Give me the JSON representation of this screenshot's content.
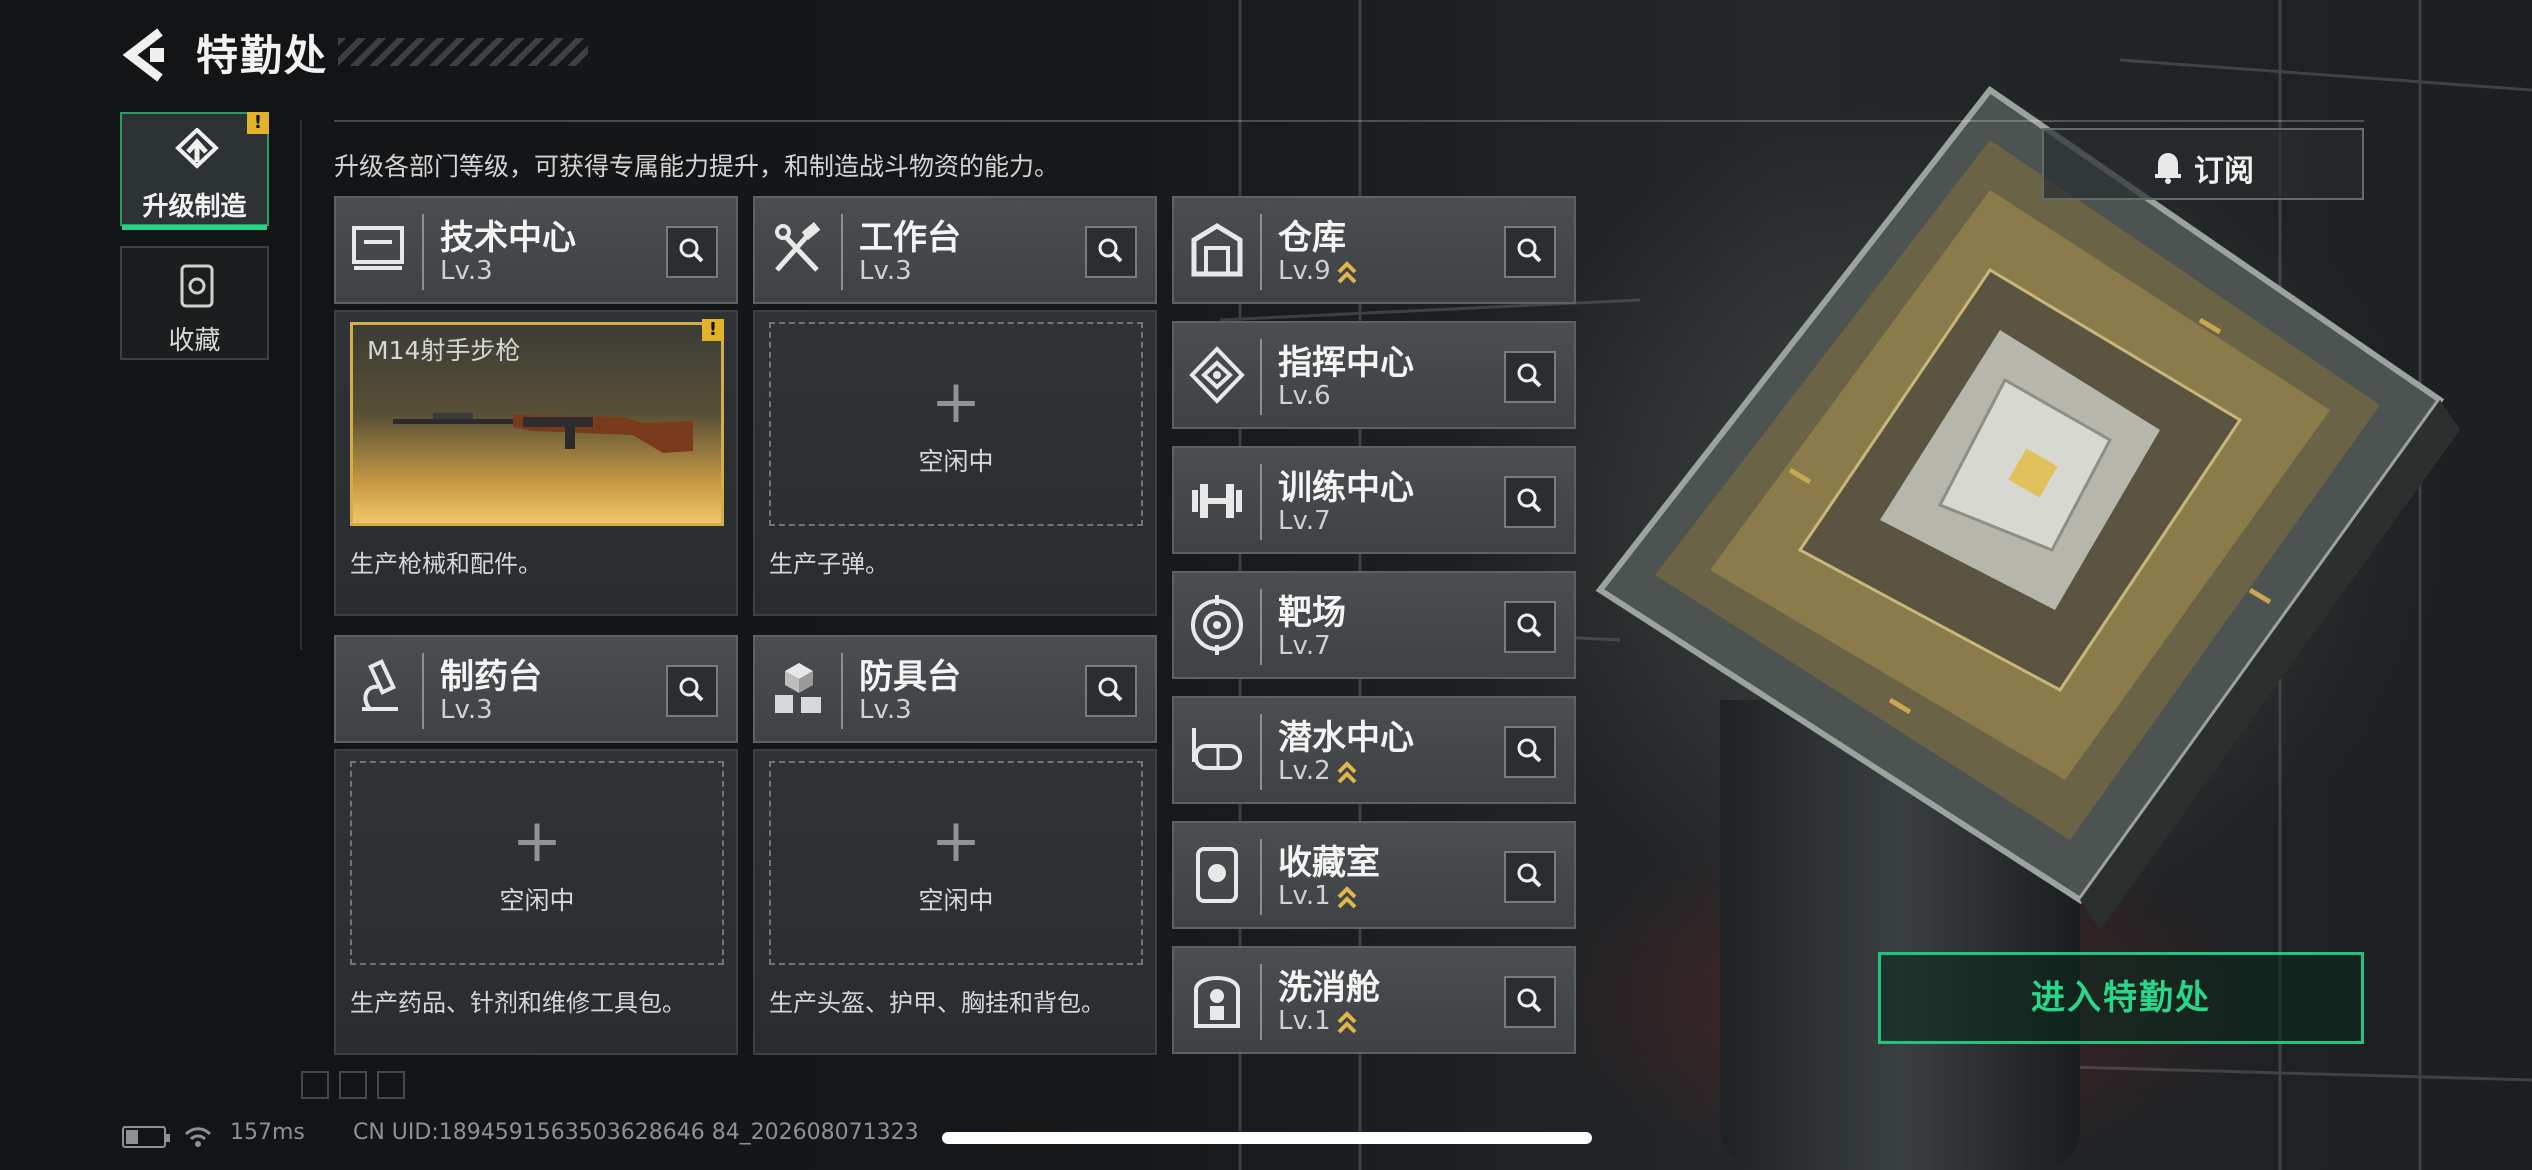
{
  "header": {
    "title": "特勤处"
  },
  "sidebar": {
    "tabs": [
      {
        "label": "升级制造",
        "active": true,
        "badge": "!"
      },
      {
        "label": "收藏",
        "active": false
      }
    ]
  },
  "subtitle": "升级各部门等级，可获得专属能力提升，和制造战斗物资的能力。",
  "production_depts": [
    {
      "name": "技术中心",
      "level": "Lv.3",
      "icon": "monitor-icon",
      "slot": {
        "state": "active",
        "item": "M14射手步枪",
        "badge": "!"
      },
      "description": "生产枪械和配件。"
    },
    {
      "name": "工作台",
      "level": "Lv.3",
      "icon": "tools-icon",
      "slot": {
        "state": "idle",
        "plus": "+",
        "label": "空闲中"
      },
      "description": "生产子弹。"
    },
    {
      "name": "制药台",
      "level": "Lv.3",
      "icon": "microscope-icon",
      "slot": {
        "state": "idle",
        "plus": "+",
        "label": "空闲中"
      },
      "description": "生产药品、针剂和维修工具包。"
    },
    {
      "name": "防具台",
      "level": "Lv.3",
      "icon": "armor-blocks-icon",
      "slot": {
        "state": "idle",
        "plus": "+",
        "label": "空闲中"
      },
      "description": "生产头盔、护甲、胸挂和背包。"
    }
  ],
  "facilities": [
    {
      "name": "仓库",
      "level": "Lv.9",
      "upgradable": true,
      "icon": "warehouse-icon"
    },
    {
      "name": "指挥中心",
      "level": "Lv.6",
      "upgradable": false,
      "icon": "command-icon"
    },
    {
      "name": "训练中心",
      "level": "Lv.7",
      "upgradable": false,
      "icon": "dumbbell-icon"
    },
    {
      "name": "靶场",
      "level": "Lv.7",
      "upgradable": false,
      "icon": "target-icon"
    },
    {
      "name": "潜水中心",
      "level": "Lv.2",
      "upgradable": true,
      "icon": "goggles-icon"
    },
    {
      "name": "收藏室",
      "level": "Lv.1",
      "upgradable": true,
      "icon": "collection-icon"
    },
    {
      "name": "洗消舱",
      "level": "Lv.1",
      "upgradable": true,
      "icon": "decon-icon"
    }
  ],
  "subscribe": {
    "label": "订阅",
    "icon": "bell-icon"
  },
  "enter_button": {
    "label": "进入特勤处"
  },
  "footer": {
    "ping": "157ms",
    "uid": "CN UID:1894591563503628646 84_202608071323"
  },
  "colors": {
    "accent_green": "#29d78b",
    "warning_yellow": "#e2b32a",
    "upgrade_gold": "#e0b64a"
  }
}
